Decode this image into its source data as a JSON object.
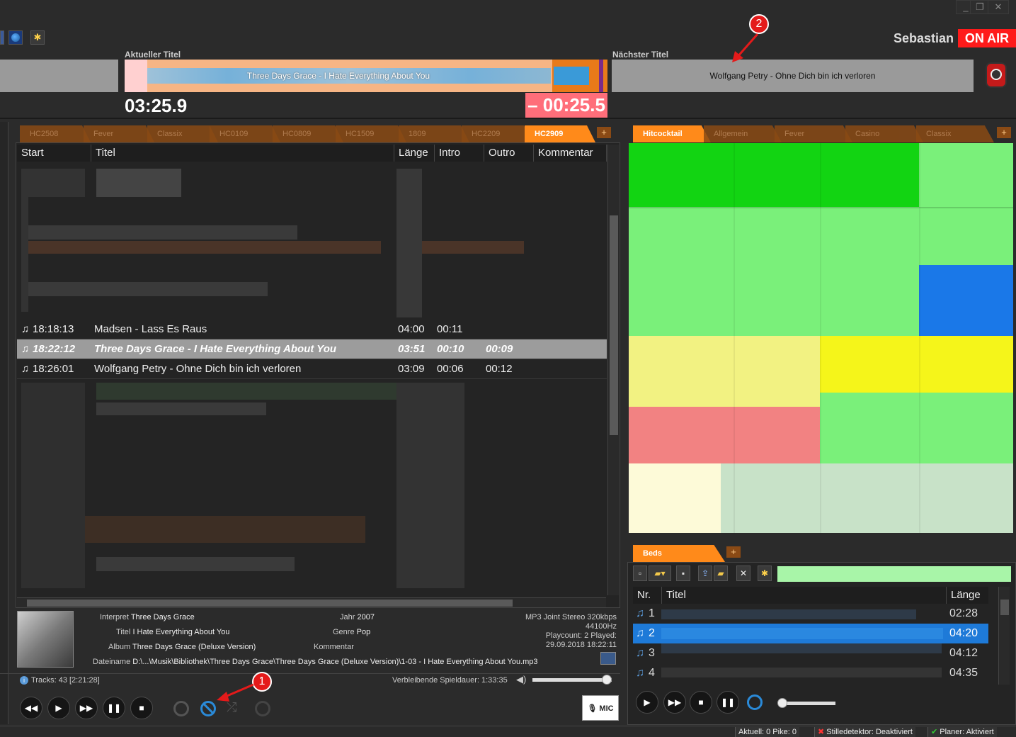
{
  "window": {
    "minimize": "_",
    "restore": "❐",
    "close": "✕"
  },
  "user": {
    "name": "Sebastian",
    "on_air": "ON AIR"
  },
  "current": {
    "label": "Aktueller Titel",
    "title": "Three Days Grace - I Hate Everything About You",
    "elapsed": "03:25.9",
    "remaining": "– 00:25.5"
  },
  "next": {
    "label": "Nächster Titel",
    "title": "Wolfgang Petry - Ohne Dich bin ich verloren"
  },
  "annotations": {
    "one": "1",
    "two": "2"
  },
  "playlist_tabs": [
    {
      "label": "HC2508"
    },
    {
      "label": "Fever"
    },
    {
      "label": "Classix"
    },
    {
      "label": "HC0109"
    },
    {
      "label": "HC0809"
    },
    {
      "label": "HC1509"
    },
    {
      "label": "1809"
    },
    {
      "label": "HC2209"
    },
    {
      "label": "HC2909",
      "active": true
    }
  ],
  "tab_plus": "+",
  "columns": {
    "start": "Start",
    "titel": "Titel",
    "laenge": "Länge",
    "intro": "Intro",
    "outro": "Outro",
    "kommentar": "Kommentar"
  },
  "rows": [
    {
      "start": "18:18:13",
      "titel": "Madsen - Lass Es Raus",
      "laenge": "04:00",
      "intro": "00:11",
      "outro": "",
      "selected": false
    },
    {
      "start": "18:22:12",
      "titel": "Three Days Grace - I Hate Everything About You",
      "laenge": "03:51",
      "intro": "00:10",
      "outro": "00:09",
      "selected": true
    },
    {
      "start": "18:26:01",
      "titel": "Wolfgang Petry - Ohne Dich bin ich verloren",
      "laenge": "03:09",
      "intro": "00:06",
      "outro": "00:12",
      "selected": false
    }
  ],
  "track_info": {
    "interpret_label": "Interpret",
    "interpret": "Three Days Grace",
    "titel_label": "Titel",
    "titel": "I Hate Everything About You",
    "album_label": "Album",
    "album": "Three Days Grace (Deluxe Version)",
    "dateiname_label": "Dateiname",
    "dateiname": "D:\\...\\Musik\\Bibliothek\\Three Days Grace\\Three Days Grace (Deluxe Version)\\1-03 - I Hate Everything About You.mp3",
    "jahr_label": "Jahr",
    "jahr": "2007",
    "genre_label": "Genre",
    "genre": "Pop",
    "kommentar_label": "Kommentar",
    "format": "MP3 Joint Stereo 320kbps",
    "rate": "44100Hz",
    "playcount": "Playcount: 2  Played:",
    "played": "29.09.2018 18:22:11"
  },
  "footer": {
    "tracks": "Tracks: 43 [2:21:28]",
    "remaining": "Verbleibende Spieldauer: 1:33:35",
    "mic": "MIC"
  },
  "cart_tabs": [
    {
      "label": "Hitcocktail",
      "active": true
    },
    {
      "label": "Allgemein"
    },
    {
      "label": "Fever"
    },
    {
      "label": "Casino"
    },
    {
      "label": "Classix"
    }
  ],
  "beds": {
    "tab": "Beds",
    "col_nr": "Nr.",
    "col_titel": "Titel",
    "col_laenge": "Länge",
    "rows": [
      {
        "nr": "1",
        "laenge": "02:28"
      },
      {
        "nr": "2",
        "laenge": "04:20",
        "selected": true
      },
      {
        "nr": "3",
        "laenge": "04:12"
      },
      {
        "nr": "4",
        "laenge": "04:35"
      }
    ]
  },
  "statusbar": {
    "aktuell": "Aktuell: 0  Pike: 0",
    "stille": "Stilledetektor: Deaktiviert",
    "planer": "Planer: Aktiviert"
  },
  "icons": [
    "globe-icon",
    "gear-icon",
    "speaker-icon",
    "mic-icon",
    "play-icon",
    "pause-icon",
    "stop-icon",
    "info-icon",
    "volume-icon",
    "note-icon"
  ],
  "colors": {
    "accent": "#ff8a1a",
    "on_air": "#ff1a1a",
    "remaining_bg": "#ff6e7a",
    "selected_bed": "#1e7ad8"
  }
}
